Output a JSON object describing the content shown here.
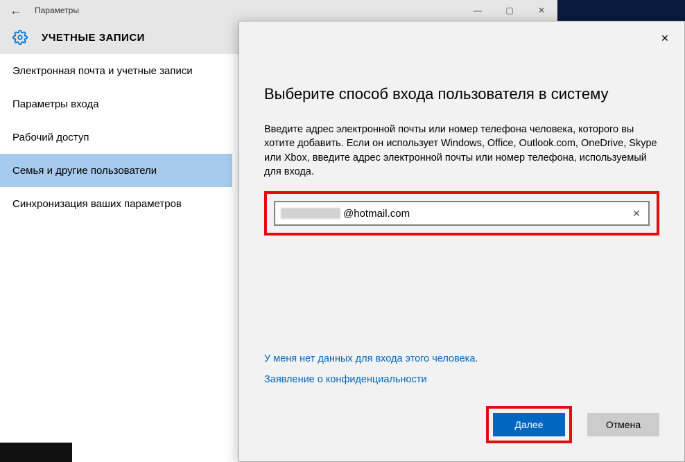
{
  "settings": {
    "window_title": "Параметры",
    "heading": "УЧЕТНЫЕ ЗАПИСИ",
    "back_glyph": "←",
    "sidebar_items": [
      "Электронная почта и учетные записи",
      "Параметры входа",
      "Рабочий доступ",
      "Семья и другие пользователи",
      "Синхронизация ваших параметров"
    ],
    "selected_index": 3,
    "winctrls": {
      "min": "—",
      "max": "▢",
      "close": "✕"
    }
  },
  "modal": {
    "close_glyph": "✕",
    "title": "Выберите способ входа пользователя в систему",
    "description": "Введите адрес электронной почты или номер телефона человека, которого вы хотите добавить. Если он использует Windows, Office, Outlook.com, OneDrive, Skype или Xbox, введите адрес электронной почты или номер телефона, используемый для входа.",
    "email_value": "@hotmail.com",
    "clear_glyph": "✕",
    "link_no_data": "У меня нет данных для входа этого человека.",
    "link_privacy": "Заявление о конфиденциальности",
    "btn_next": "Далее",
    "btn_cancel": "Отмена"
  }
}
